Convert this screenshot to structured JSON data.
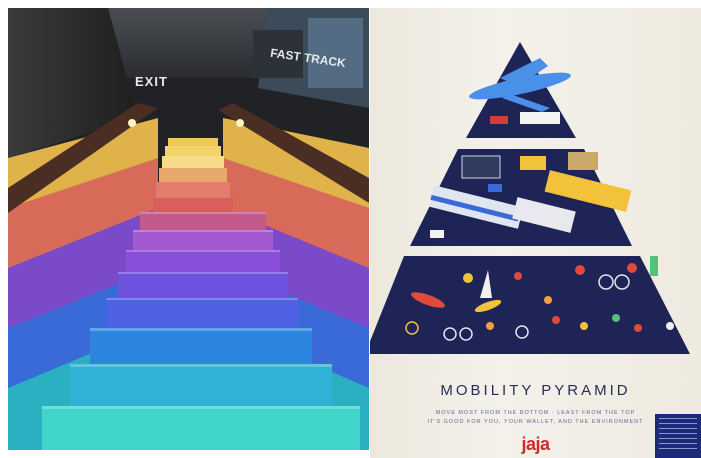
{
  "photos": [
    {
      "id_label": "rainbow-staircase",
      "signs": {
        "exit": "EXIT",
        "fast_track": "FAST TRACK"
      },
      "colors": {
        "top": "#f5d24a",
        "middle": "#8a4fd8",
        "bottom": "#3fd6c9",
        "handrail": "#6a4a3a"
      }
    },
    {
      "id_label": "mobility-pyramid-poster",
      "title": "MOBILITY PYRAMID",
      "subtitle_line1": "MOVE MOST FROM THE BOTTOM · LEAST FROM THE TOP",
      "subtitle_line2": "IT'S GOOD FOR YOU, YOUR WALLET, AND THE ENVIRONMENT",
      "logo": "jaja",
      "colors": {
        "pyramid": "#1f2456",
        "title": "#2a2d57",
        "logo": "#d12a2a",
        "card": "#1d2a7a"
      }
    }
  ]
}
